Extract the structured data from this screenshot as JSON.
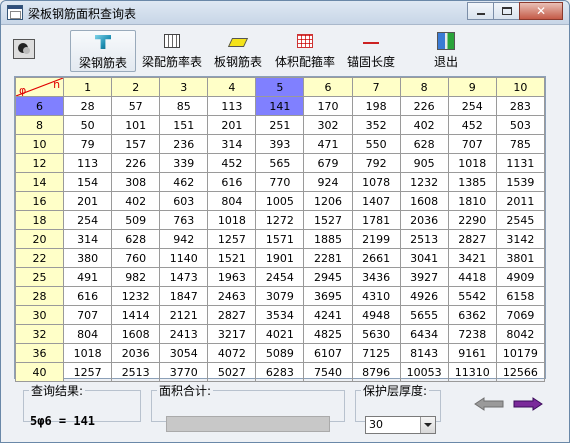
{
  "window": {
    "title": "梁板钢筋面积查询表"
  },
  "toolbar": {
    "beam_steel": "梁钢筋表",
    "beam_ratio": "梁配筋率表",
    "slab_steel": "板钢筋表",
    "volume_ratio": "体积配箍率",
    "anchor_length": "锚固长度",
    "exit": "退出"
  },
  "table": {
    "corner_phi": "φ",
    "corner_n": "n",
    "columns": [
      "1",
      "2",
      "3",
      "4",
      "5",
      "6",
      "7",
      "8",
      "9",
      "10"
    ],
    "rows": [
      {
        "d": "6",
        "v": [
          "28",
          "57",
          "85",
          "113",
          "141",
          "170",
          "198",
          "226",
          "254",
          "283"
        ]
      },
      {
        "d": "8",
        "v": [
          "50",
          "101",
          "151",
          "201",
          "251",
          "302",
          "352",
          "402",
          "452",
          "503"
        ]
      },
      {
        "d": "10",
        "v": [
          "79",
          "157",
          "236",
          "314",
          "393",
          "471",
          "550",
          "628",
          "707",
          "785"
        ]
      },
      {
        "d": "12",
        "v": [
          "113",
          "226",
          "339",
          "452",
          "565",
          "679",
          "792",
          "905",
          "1018",
          "1131"
        ]
      },
      {
        "d": "14",
        "v": [
          "154",
          "308",
          "462",
          "616",
          "770",
          "924",
          "1078",
          "1232",
          "1385",
          "1539"
        ]
      },
      {
        "d": "16",
        "v": [
          "201",
          "402",
          "603",
          "804",
          "1005",
          "1206",
          "1407",
          "1608",
          "1810",
          "2011"
        ]
      },
      {
        "d": "18",
        "v": [
          "254",
          "509",
          "763",
          "1018",
          "1272",
          "1527",
          "1781",
          "2036",
          "2290",
          "2545"
        ]
      },
      {
        "d": "20",
        "v": [
          "314",
          "628",
          "942",
          "1257",
          "1571",
          "1885",
          "2199",
          "2513",
          "2827",
          "3142"
        ]
      },
      {
        "d": "22",
        "v": [
          "380",
          "760",
          "1140",
          "1521",
          "1901",
          "2281",
          "2661",
          "3041",
          "3421",
          "3801"
        ]
      },
      {
        "d": "25",
        "v": [
          "491",
          "982",
          "1473",
          "1963",
          "2454",
          "2945",
          "3436",
          "3927",
          "4418",
          "4909"
        ]
      },
      {
        "d": "28",
        "v": [
          "616",
          "1232",
          "1847",
          "2463",
          "3079",
          "3695",
          "4310",
          "4926",
          "5542",
          "6158"
        ]
      },
      {
        "d": "30",
        "v": [
          "707",
          "1414",
          "2121",
          "2827",
          "3534",
          "4241",
          "4948",
          "5655",
          "6362",
          "7069"
        ]
      },
      {
        "d": "32",
        "v": [
          "804",
          "1608",
          "2413",
          "3217",
          "4021",
          "4825",
          "5630",
          "6434",
          "7238",
          "8042"
        ]
      },
      {
        "d": "36",
        "v": [
          "1018",
          "2036",
          "3054",
          "4072",
          "5089",
          "6107",
          "7125",
          "8143",
          "9161",
          "10179"
        ]
      },
      {
        "d": "40",
        "v": [
          "1257",
          "2513",
          "3770",
          "5027",
          "6283",
          "7540",
          "8796",
          "10053",
          "11310",
          "12566"
        ]
      }
    ],
    "selected_row": 0,
    "selected_col": 4,
    "highlight_color": "#8080ff",
    "header_color": "#ffffc8"
  },
  "result": {
    "label": "查询结果:",
    "text": "5φ6 = 141"
  },
  "sum": {
    "label": "面积合计:",
    "value": ""
  },
  "cover": {
    "label": "保护层厚度:",
    "value": "30"
  }
}
